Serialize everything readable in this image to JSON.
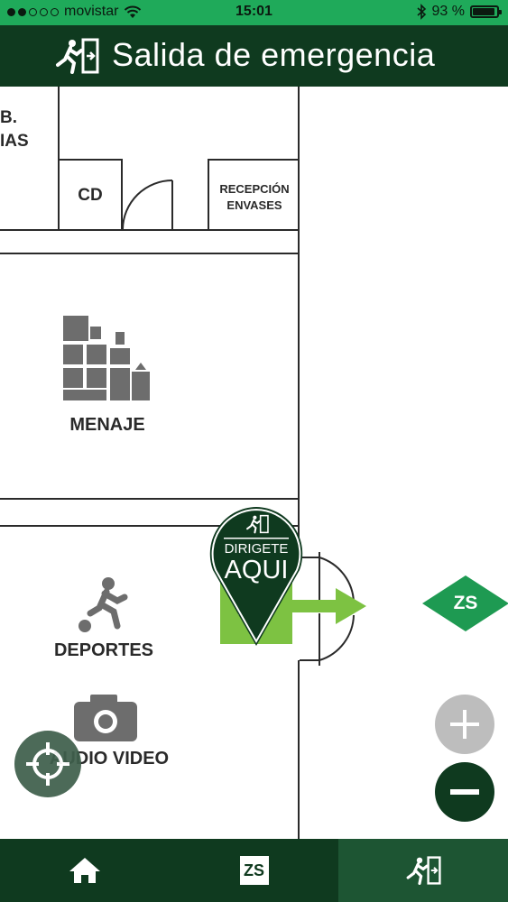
{
  "status_bar": {
    "carrier": "movistar",
    "time": "15:01",
    "battery": "93 %",
    "battery_level": 0.93
  },
  "header": {
    "title": "Salida de emergencia",
    "icon": "emergency-exit-icon"
  },
  "map": {
    "rooms": {
      "partial_top_line1": "B.",
      "partial_top_line2": "IAS",
      "cd": "CD",
      "recepcion_line1": "RECEPCIÓN",
      "recepcion_line2": "ENVASES",
      "menaje": "MENAJE",
      "deportes": "DEPORTES",
      "audio_video": "AUDIO VIDEO"
    },
    "pin": {
      "line1": "DIRIGETE",
      "line2": "AQUI"
    },
    "zone_badge": "ZS"
  },
  "colors": {
    "header_dark_green": "#0f3a1f",
    "status_green": "#1faa5a",
    "exit_green": "#7dc242",
    "zs_green": "#1e9a52"
  },
  "tabs": [
    {
      "name": "home",
      "icon": "home-icon"
    },
    {
      "name": "zs",
      "label": "ZS"
    },
    {
      "name": "exit",
      "icon": "emergency-exit-icon",
      "active": true
    }
  ]
}
